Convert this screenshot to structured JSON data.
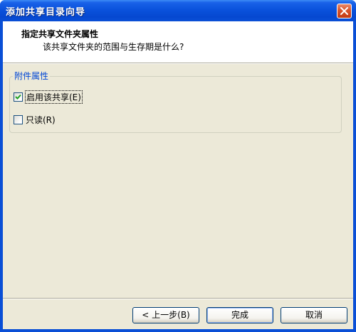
{
  "window": {
    "title": "添加共享目录向导"
  },
  "header": {
    "title": "指定共享文件夹属性",
    "subtitle": "该共享文件夹的范围与生存期是什么?"
  },
  "group": {
    "legend": "附件属性",
    "options": [
      {
        "label": "启用该共享(E)",
        "checked": true
      },
      {
        "label": "只读(R)",
        "checked": false
      }
    ]
  },
  "buttons": {
    "back": "< 上一步(B)",
    "finish": "完成",
    "cancel": "取消"
  },
  "colors": {
    "titlebar": "#0a4fd6",
    "client": "#ece9d8",
    "legend": "#0046d5"
  }
}
